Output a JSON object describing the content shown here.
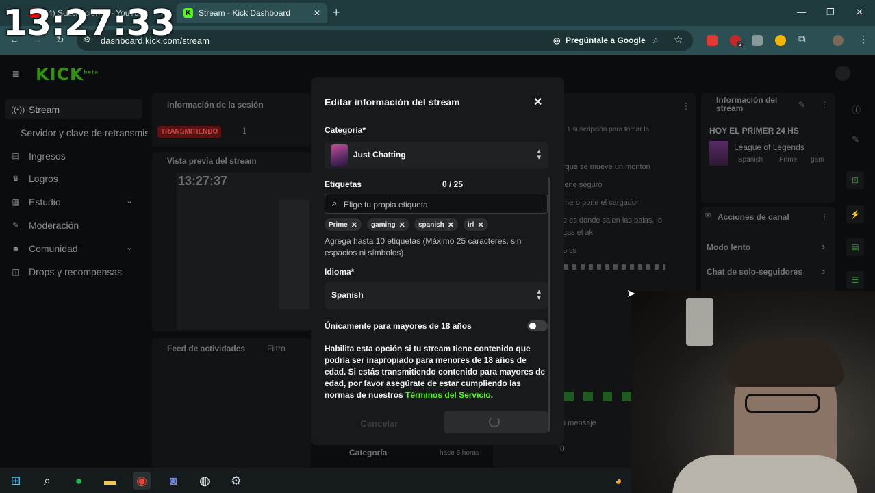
{
  "overlay_clock": "13:27:33",
  "browser": {
    "tabs": [
      {
        "title": "(4) Suscripciones - YouTube",
        "active": false,
        "favicon_color": "#ff0000"
      },
      {
        "title": "Stream - Kick Dashboard",
        "active": true,
        "favicon_color": "#53fc18"
      }
    ],
    "url": "dashboard.kick.com/stream",
    "google_pill": "Pregúntale a Google",
    "ext_badge": "2"
  },
  "logo": {
    "text": "KICK",
    "sup": "beta"
  },
  "sidebar": {
    "items": [
      {
        "icon": "broadcast-icon",
        "label": "Stream",
        "active": true
      },
      {
        "label": "Servidor y clave de retransmisión"
      },
      {
        "icon": "income-icon",
        "label": "Ingresos"
      },
      {
        "icon": "trophy-icon",
        "label": "Logros"
      },
      {
        "icon": "studio-icon",
        "label": "Estudio",
        "expandable": true
      },
      {
        "icon": "moderation-icon",
        "label": "Moderación"
      },
      {
        "icon": "community-icon",
        "label": "Comunidad",
        "expandable": true
      },
      {
        "icon": "drops-icon",
        "label": "Drops y recompensas"
      }
    ]
  },
  "session_panel": {
    "title": "Información de la sesión",
    "status": "TRANSMITIENDO",
    "count": "1"
  },
  "preview_panel": {
    "title": "Vista previa del stream",
    "time": "13:27:37"
  },
  "feed_panel": {
    "title": "Feed de actividades",
    "filter": "Filtro",
    "category": "Categoría",
    "when": "hace 6 horas"
  },
  "chat_panel": {
    "lines": [
      "1 suscripción para tomar la",
      "rque se mueve un montón",
      "iene seguro",
      "mero pone el cargador",
      "e es donde salen las balas, lo",
      "gas el ak",
      "o cs"
    ],
    "placeholder": "n mensaje",
    "counter": "0"
  },
  "stream_info_panel": {
    "title": "Información del stream",
    "stream_title": "HOY EL PRIMER 24 HS",
    "game": "League of Legends",
    "tags": [
      "Spanish",
      "Prime",
      "gam"
    ]
  },
  "channel_actions": {
    "title": "Acciones de canal",
    "items": [
      "Modo lento",
      "Chat de solo-seguidores"
    ]
  },
  "modal": {
    "title": "Editar información del stream",
    "category_label": "Categoría*",
    "category_value": "Just Chatting",
    "tags_label": "Etiquetas",
    "tags_count": "0 / 25",
    "tags_placeholder": "Elige tu propia etiqueta",
    "tags": [
      "Prime",
      "gaming",
      "spanish",
      "irl"
    ],
    "tags_help": "Agrega hasta 10 etiquetas (Máximo 25 caracteres, sin espacios ni símbolos).",
    "language_label": "Idioma*",
    "language_value": "Spanish",
    "mature_label": "Únicamente para mayores de 18 años",
    "mature_on": false,
    "mature_desc": "Habilita esta opción si tu stream tiene contenido que podría ser inapropiado para menores de 18 años de edad. Si estás transmitiendo contenido para mayores de edad, por favor asegúrate de estar cumpliendo las normas de nuestros",
    "tos_link": "Términos del Servicio",
    "tos_end": ".",
    "cancel": "Cancelar"
  },
  "taskbar": {
    "apps": [
      "windows-start-icon",
      "search-icon",
      "spotify-icon",
      "file-explorer-icon",
      "chrome-icon",
      "discord-icon",
      "obs-icon",
      "steam-icon"
    ]
  }
}
